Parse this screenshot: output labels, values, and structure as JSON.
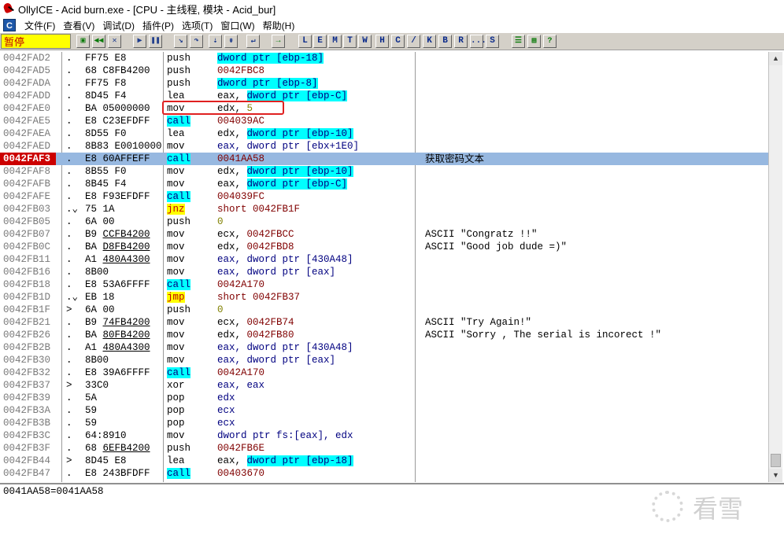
{
  "window": {
    "title": "OllyICE - Acid burn.exe - [CPU - 主线程, 模块 - Acid_bur]"
  },
  "menu": {
    "icon_letter": "C",
    "items": [
      "文件(F)",
      "查看(V)",
      "调试(D)",
      "插件(P)",
      "选项(T)",
      "窗口(W)",
      "帮助(H)"
    ]
  },
  "toolbar": {
    "status": "暂停",
    "letters": [
      "L",
      "E",
      "M",
      "T",
      "W",
      "H",
      "C",
      "/",
      "K",
      "B",
      "R",
      "...",
      "S"
    ]
  },
  "rows": [
    {
      "addr": "0042FAD2",
      "mark": ".",
      "hex": "FF75 E8",
      "mnem": "push",
      "operand": [
        {
          "t": "dword ptr [ebp-18]",
          "s": "cyan"
        }
      ],
      "comment": ""
    },
    {
      "addr": "0042FAD5",
      "mark": ".",
      "hex": "68 C8FB4200",
      "mnem": "push",
      "operand": [
        {
          "t": "0042FBC8",
          "s": "red"
        }
      ],
      "comment": ""
    },
    {
      "addr": "0042FADA",
      "mark": ".",
      "hex": "FF75 F8",
      "mnem": "push",
      "operand": [
        {
          "t": "dword ptr [ebp-8]",
          "s": "cyan"
        }
      ],
      "comment": ""
    },
    {
      "addr": "0042FADD",
      "mark": ".",
      "hex": "8D45 F4",
      "mnem": "lea",
      "operand": [
        {
          "t": "eax, "
        },
        {
          "t": "dword ptr [ebp-C]",
          "s": "cyan"
        }
      ],
      "comment": ""
    },
    {
      "addr": "0042FAE0",
      "mark": ".",
      "hex": "BA 05000000",
      "mnem": "mov",
      "operand": [
        {
          "t": "edx, "
        },
        {
          "t": "5",
          "s": "olive"
        }
      ],
      "comment": ""
    },
    {
      "addr": "0042FAE5",
      "mark": ".",
      "hex": "E8 C23EFDFF",
      "mnem": "call",
      "mnem_style": "cyan",
      "operand": [
        {
          "t": "004039AC",
          "s": "red"
        }
      ],
      "comment": ""
    },
    {
      "addr": "0042FAEA",
      "mark": ".",
      "hex": "8D55 F0",
      "mnem": "lea",
      "operand": [
        {
          "t": "edx, "
        },
        {
          "t": "dword ptr [ebp-10]",
          "s": "cyan"
        }
      ],
      "comment": ""
    },
    {
      "addr": "0042FAED",
      "mark": ".",
      "hex": "8B83 E0010000",
      "mnem": "mov",
      "operand": [
        {
          "t": "eax, dword ptr [ebx+1E0]",
          "s": "navy"
        }
      ],
      "comment": ""
    },
    {
      "addr": "0042FAF3",
      "mark": ".",
      "hex": "E8 60AFFEFF",
      "mnem": "call",
      "mnem_style": "cyan",
      "operand": [
        {
          "t": "0041AA58",
          "s": "red"
        }
      ],
      "comment": "获取密码文本",
      "selected": true
    },
    {
      "addr": "0042FAF8",
      "mark": ".",
      "hex": "8B55 F0",
      "mnem": "mov",
      "operand": [
        {
          "t": "edx, "
        },
        {
          "t": "dword ptr [ebp-10]",
          "s": "cyan"
        }
      ],
      "comment": ""
    },
    {
      "addr": "0042FAFB",
      "mark": ".",
      "hex": "8B45 F4",
      "mnem": "mov",
      "operand": [
        {
          "t": "eax, "
        },
        {
          "t": "dword ptr [ebp-C]",
          "s": "cyan"
        }
      ],
      "comment": ""
    },
    {
      "addr": "0042FAFE",
      "mark": ".",
      "hex": "E8 F93EFDFF",
      "mnem": "call",
      "mnem_style": "cyan",
      "operand": [
        {
          "t": "004039FC",
          "s": "red"
        }
      ],
      "comment": ""
    },
    {
      "addr": "0042FB03",
      "mark": ".⌄",
      "hex": "75 1A",
      "mnem": "jnz",
      "mnem_style": "yellow",
      "operand": [
        {
          "t": "short 0042FB1F",
          "s": "red"
        }
      ],
      "comment": ""
    },
    {
      "addr": "0042FB05",
      "mark": ".",
      "hex": "6A 00",
      "mnem": "push",
      "operand": [
        {
          "t": "0",
          "s": "olive"
        }
      ],
      "comment": ""
    },
    {
      "addr": "0042FB07",
      "mark": ".",
      "hex": "B9 CCFB4200",
      "hex_ul": "CCFB4200",
      "mnem": "mov",
      "operand": [
        {
          "t": "ecx, "
        },
        {
          "t": "0042FBCC",
          "s": "red"
        }
      ],
      "comment": "ASCII \"Congratz !!\""
    },
    {
      "addr": "0042FB0C",
      "mark": ".",
      "hex": "BA D8FB4200",
      "hex_ul": "D8FB4200",
      "mnem": "mov",
      "operand": [
        {
          "t": "edx, "
        },
        {
          "t": "0042FBD8",
          "s": "red"
        }
      ],
      "comment": "ASCII \"Good job dude =)\""
    },
    {
      "addr": "0042FB11",
      "mark": ".",
      "hex": "A1 480A4300",
      "hex_ul": "480A4300",
      "mnem": "mov",
      "operand": [
        {
          "t": "eax, dword ptr [430A48]",
          "s": "navy"
        }
      ],
      "comment": ""
    },
    {
      "addr": "0042FB16",
      "mark": ".",
      "hex": "8B00",
      "mnem": "mov",
      "operand": [
        {
          "t": "eax, dword ptr [eax]",
          "s": "navy"
        }
      ],
      "comment": ""
    },
    {
      "addr": "0042FB18",
      "mark": ".",
      "hex": "E8 53A6FFFF",
      "mnem": "call",
      "mnem_style": "cyan",
      "operand": [
        {
          "t": "0042A170",
          "s": "red"
        }
      ],
      "comment": ""
    },
    {
      "addr": "0042FB1D",
      "mark": ".⌄",
      "hex": "EB 18",
      "mnem": "jmp",
      "mnem_style": "yellow",
      "operand": [
        {
          "t": "short 0042FB37",
          "s": "red"
        }
      ],
      "comment": ""
    },
    {
      "addr": "0042FB1F",
      "mark": ">",
      "hex": "6A 00",
      "mnem": "push",
      "operand": [
        {
          "t": "0",
          "s": "olive"
        }
      ],
      "comment": ""
    },
    {
      "addr": "0042FB21",
      "mark": ".",
      "hex": "B9 74FB4200",
      "hex_ul": "74FB4200",
      "mnem": "mov",
      "operand": [
        {
          "t": "ecx, "
        },
        {
          "t": "0042FB74",
          "s": "red"
        }
      ],
      "comment": "ASCII \"Try Again!\""
    },
    {
      "addr": "0042FB26",
      "mark": ".",
      "hex": "BA 80FB4200",
      "hex_ul": "80FB4200",
      "mnem": "mov",
      "operand": [
        {
          "t": "edx, "
        },
        {
          "t": "0042FB80",
          "s": "red"
        }
      ],
      "comment": "ASCII \"Sorry , The serial is incorect !\""
    },
    {
      "addr": "0042FB2B",
      "mark": ".",
      "hex": "A1 480A4300",
      "hex_ul": "480A4300",
      "mnem": "mov",
      "operand": [
        {
          "t": "eax, dword ptr [430A48]",
          "s": "navy"
        }
      ],
      "comment": ""
    },
    {
      "addr": "0042FB30",
      "mark": ".",
      "hex": "8B00",
      "mnem": "mov",
      "operand": [
        {
          "t": "eax, dword ptr [eax]",
          "s": "navy"
        }
      ],
      "comment": ""
    },
    {
      "addr": "0042FB32",
      "mark": ".",
      "hex": "E8 39A6FFFF",
      "mnem": "call",
      "mnem_style": "cyan",
      "operand": [
        {
          "t": "0042A170",
          "s": "red"
        }
      ],
      "comment": ""
    },
    {
      "addr": "0042FB37",
      "mark": ">",
      "hex": "33C0",
      "mnem": "xor",
      "operand": [
        {
          "t": "eax, eax",
          "s": "navy"
        }
      ],
      "comment": ""
    },
    {
      "addr": "0042FB39",
      "mark": ".",
      "hex": "5A",
      "mnem": "pop",
      "operand": [
        {
          "t": "edx",
          "s": "navy"
        }
      ],
      "comment": ""
    },
    {
      "addr": "0042FB3A",
      "mark": ".",
      "hex": "59",
      "mnem": "pop",
      "operand": [
        {
          "t": "ecx",
          "s": "navy"
        }
      ],
      "comment": ""
    },
    {
      "addr": "0042FB3B",
      "mark": ".",
      "hex": "59",
      "mnem": "pop",
      "operand": [
        {
          "t": "ecx",
          "s": "navy"
        }
      ],
      "comment": ""
    },
    {
      "addr": "0042FB3C",
      "mark": ".",
      "hex": "64:8910",
      "mnem": "mov",
      "operand": [
        {
          "t": "dword ptr fs:[eax], edx",
          "s": "navy"
        }
      ],
      "comment": ""
    },
    {
      "addr": "0042FB3F",
      "mark": ".",
      "hex": "68 6EFB4200",
      "hex_ul": "6EFB4200",
      "mnem": "push",
      "operand": [
        {
          "t": "0042FB6E",
          "s": "red"
        }
      ],
      "comment": ""
    },
    {
      "addr": "0042FB44",
      "mark": ">",
      "hex": "8D45 E8",
      "mnem": "lea",
      "operand": [
        {
          "t": "eax, "
        },
        {
          "t": "dword ptr [ebp-18]",
          "s": "cyan"
        }
      ],
      "comment": ""
    },
    {
      "addr": "0042FB47",
      "mark": ".",
      "hex": "E8 243BFDFF",
      "mnem": "call",
      "mnem_style": "cyan",
      "operand": [
        {
          "t": "00403670",
          "s": "red"
        }
      ],
      "comment": ""
    }
  ],
  "info": {
    "text": "0041AA58=0041AA58"
  },
  "watermark": {
    "text": "看雪"
  }
}
